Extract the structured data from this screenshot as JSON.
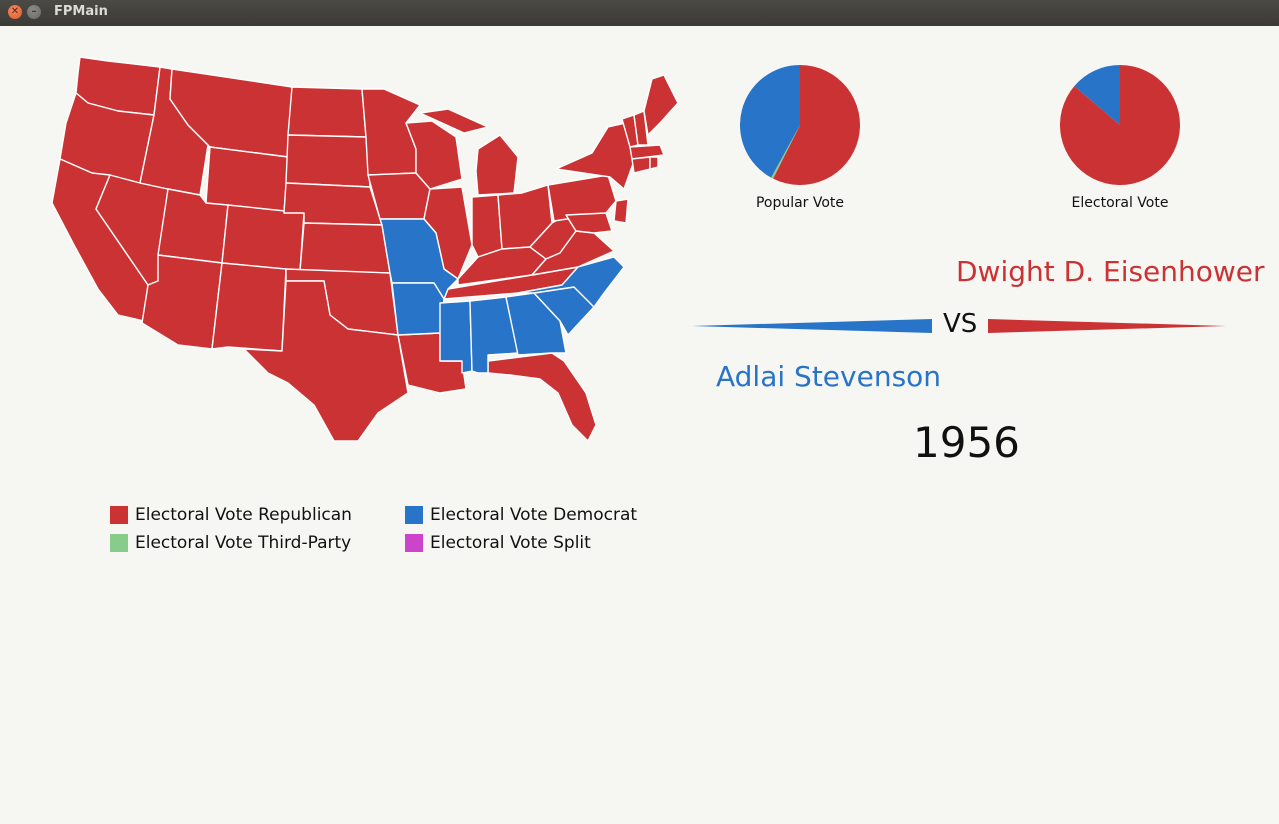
{
  "window": {
    "title": "FPMain"
  },
  "colors": {
    "republican": "#cb3234",
    "democrat": "#2874c8",
    "third_party": "#88cc8c",
    "split": "#cc44cc"
  },
  "popular_vote": {
    "label": "Popular Vote",
    "slices": {
      "republican": 57.4,
      "democrat": 42.0,
      "third_party": 0.6
    }
  },
  "electoral_vote": {
    "label": "Electoral Vote",
    "slices": {
      "republican": 457,
      "democrat": 73,
      "third_party": 0
    }
  },
  "matchup": {
    "republican_candidate": "Dwight D. Eisenhower",
    "democrat_candidate": "Adlai Stevenson",
    "vs_label": "VS",
    "year": "1956"
  },
  "legend": {
    "republican": "Electoral Vote Republican",
    "democrat": "Electoral Vote Democrat",
    "third_party": "Electoral Vote Third-Party",
    "split": "Electoral Vote Split"
  }
}
